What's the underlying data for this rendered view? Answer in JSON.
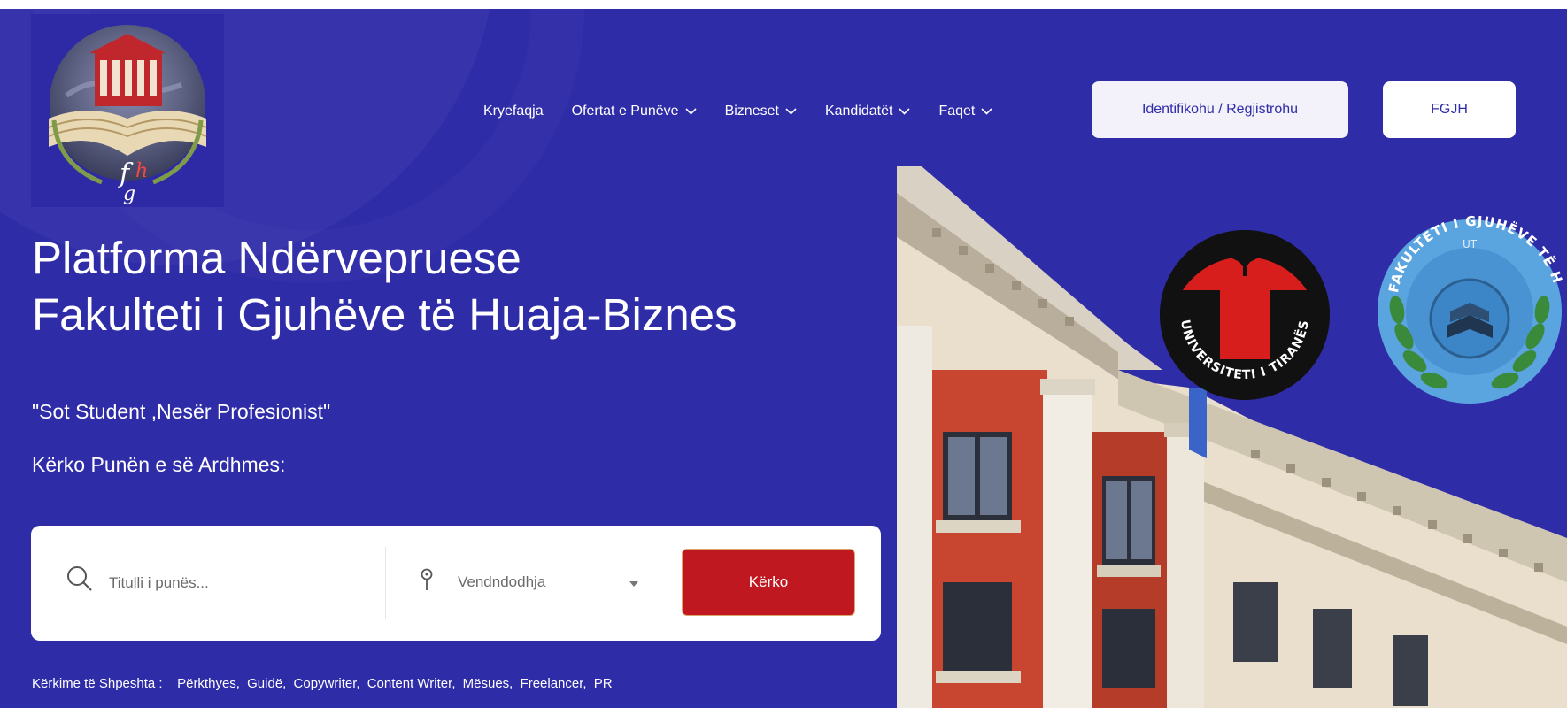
{
  "nav": {
    "items": [
      {
        "label": "Kryefaqja",
        "has_dropdown": false
      },
      {
        "label": "Ofertat e Punëve",
        "has_dropdown": true
      },
      {
        "label": "Bizneset",
        "has_dropdown": true
      },
      {
        "label": "Kandidatët",
        "has_dropdown": true
      },
      {
        "label": "Faqet",
        "has_dropdown": true
      }
    ],
    "login_label": "Identifikohu / Regjistrohu",
    "fgjh_label": "FGJH"
  },
  "hero": {
    "title_line1": "Platforma Ndërvepruese",
    "title_line2": "Fakulteti i Gjuhëve të Huaja-Biznes",
    "motto": "\"Sot Student ,Nesër Profesionist\"",
    "search_prompt": "Kërko Punën e së Ardhmes:"
  },
  "search": {
    "title_placeholder": "Titulli i punës...",
    "location_label": "Vendndodhja",
    "button_label": "Kërko"
  },
  "popular": {
    "label": "Kërkime të Shpeshta :",
    "tags": [
      "Përkthyes,",
      "Guidë,",
      "Copywriter,",
      "Content Writer,",
      "Mësues,",
      "Freelancer,",
      "PR"
    ]
  },
  "logos": {
    "ut_text": "UNIVERSITETI I TIRANËS",
    "fgjh_text": "FAKULTETI I GJUHËVE TË H",
    "fgjh_top": "UT"
  },
  "colors": {
    "primary": "#2f2ca8",
    "accent_red": "#c01820",
    "login_bg": "#f3f2fb"
  },
  "icons": [
    "search-icon",
    "map-pin-icon",
    "caret-down-icon",
    "chevron-down-icon"
  ]
}
